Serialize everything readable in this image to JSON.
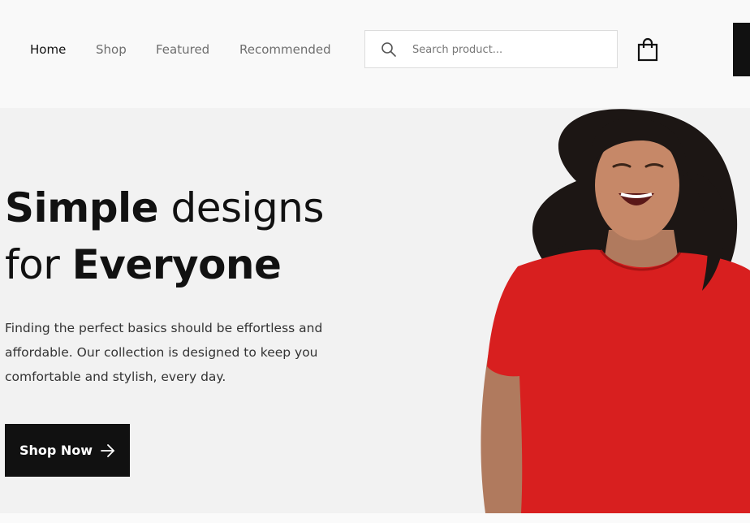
{
  "nav": {
    "links": [
      {
        "label": "Home",
        "active": true
      },
      {
        "label": "Shop",
        "active": false
      },
      {
        "label": "Featured",
        "active": false
      },
      {
        "label": "Recommended",
        "active": false
      }
    ]
  },
  "search": {
    "placeholder": "Search product...",
    "value": ""
  },
  "icons": {
    "search": "search-icon",
    "cart": "shopping-bag-icon",
    "arrow": "arrow-right-icon"
  },
  "hero": {
    "title_line1_bold": "Simple",
    "title_line1_rest": "designs",
    "title_line2_start": "for",
    "title_line2_bold": "Everyone",
    "description": "Finding the perfect basics should be effortless and affordable. Our collection is designed to keep you comfortable and stylish, every day.",
    "cta_label": "Shop Now"
  },
  "colors": {
    "accent": "#111111",
    "hero_bg": "#f2f2f2",
    "shirt": "#d81f1f"
  }
}
